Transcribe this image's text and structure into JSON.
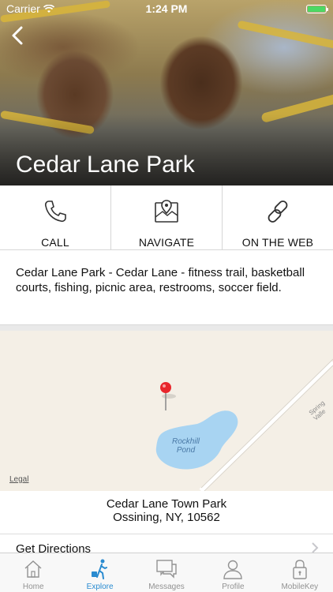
{
  "status_bar": {
    "carrier": "Carrier",
    "time": "1:24 PM"
  },
  "header": {
    "title": "Cedar Lane Park",
    "back_icon": "chevron-left-icon"
  },
  "actions": [
    {
      "label": "CALL",
      "icon": "phone-icon"
    },
    {
      "label": "NAVIGATE",
      "icon": "map-pin-icon"
    },
    {
      "label": "ON THE WEB",
      "icon": "link-icon"
    }
  ],
  "description": "Cedar Lane Park - Cedar Lane - fitness trail, basketball courts, fishing, picnic area, restrooms, soccer field.",
  "map": {
    "legal": "Legal",
    "pond_line1": "Rockhill",
    "pond_line2": "Pond",
    "road_label": "Spring Valle"
  },
  "location": {
    "name": "Cedar Lane Town Park",
    "city_line": "Ossining, NY, 10562"
  },
  "directions": {
    "label": "Get Directions"
  },
  "tabs": [
    {
      "label": "Home",
      "icon": "home-icon",
      "active": false
    },
    {
      "label": "Explore",
      "icon": "explore-icon",
      "active": true
    },
    {
      "label": "Messages",
      "icon": "messages-icon",
      "active": false
    },
    {
      "label": "Profile",
      "icon": "profile-icon",
      "active": false
    },
    {
      "label": "MobileKey",
      "icon": "mobilekey-icon",
      "active": false
    }
  ],
  "colors": {
    "accent": "#2a8bd0",
    "battery": "#4cd964",
    "pin": "#e8262c",
    "water": "#a8d4f2",
    "map_bg": "#f4efe6"
  }
}
